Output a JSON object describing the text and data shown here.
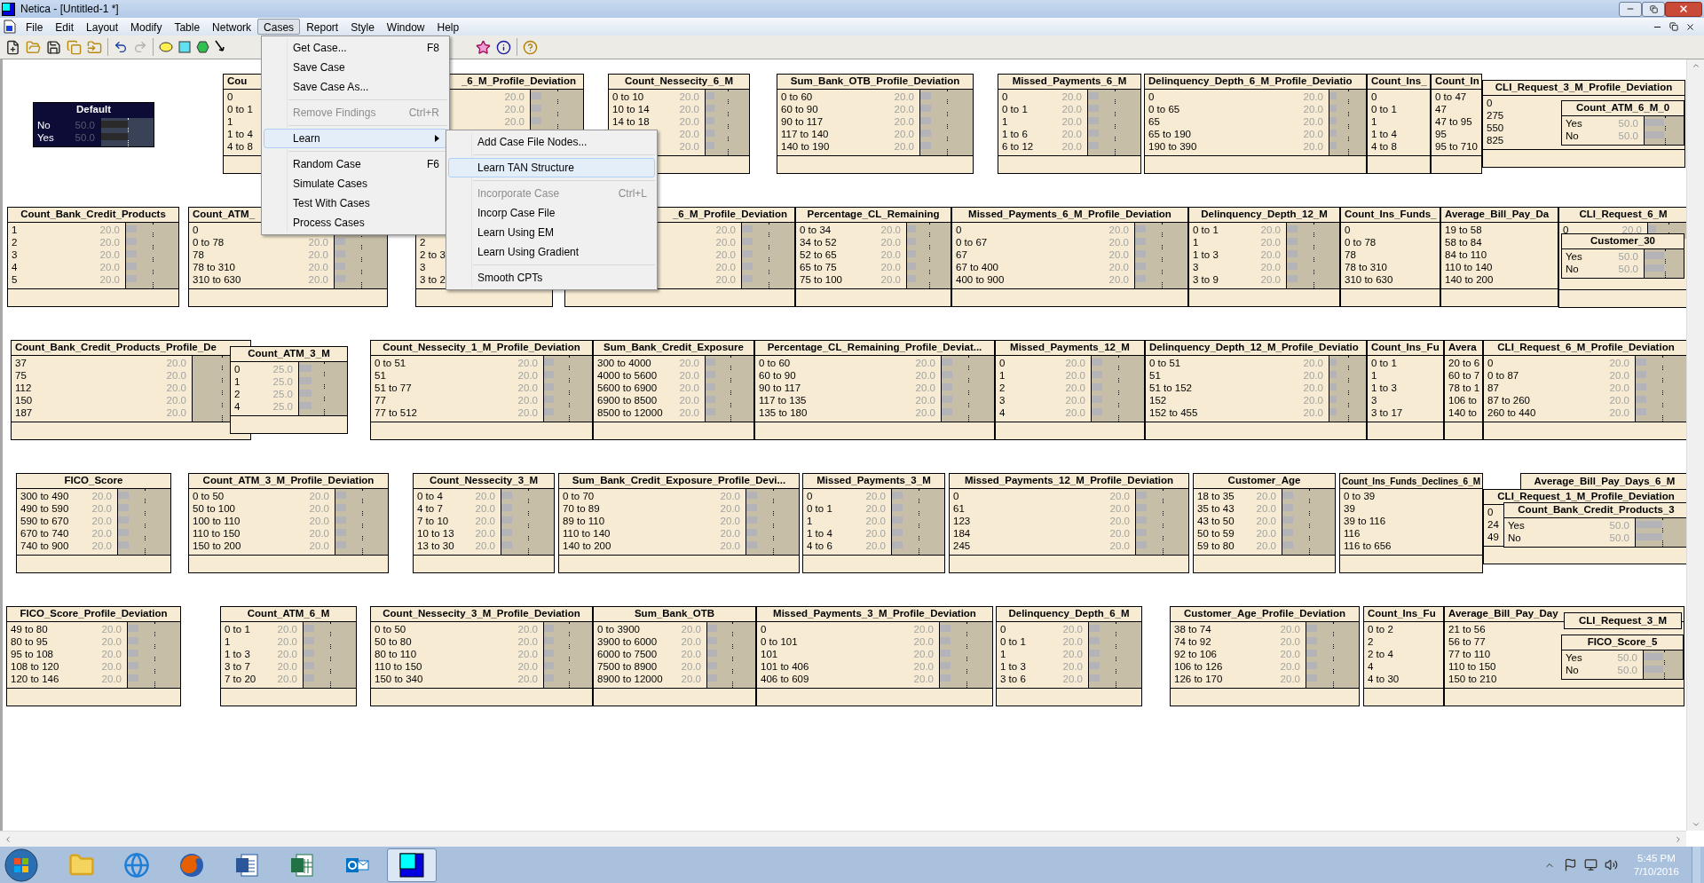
{
  "window": {
    "title": "Netica - [Untitled-1 *]"
  },
  "menu_bar": [
    {
      "label": "File",
      "selected": false
    },
    {
      "label": "Edit",
      "selected": false
    },
    {
      "label": "Layout",
      "selected": false
    },
    {
      "label": "Modify",
      "selected": false
    },
    {
      "label": "Table",
      "selected": false
    },
    {
      "label": "Network",
      "selected": false
    },
    {
      "label": "Cases",
      "selected": true
    },
    {
      "label": "Report",
      "selected": false
    },
    {
      "label": "Style",
      "selected": false
    },
    {
      "label": "Window",
      "selected": false
    },
    {
      "label": "Help",
      "selected": false
    }
  ],
  "cases_menu": {
    "groups": [
      [
        {
          "label": "Get Case...",
          "shortcut": "F8",
          "disabled": false,
          "selected": false
        },
        {
          "label": "Save Case",
          "disabled": false,
          "selected": false
        },
        {
          "label": "Save Case As...",
          "disabled": false,
          "selected": false
        }
      ],
      [
        {
          "label": "Remove Findings",
          "shortcut": "Ctrl+R",
          "disabled": true,
          "selected": false
        }
      ],
      [
        {
          "label": "Learn",
          "disabled": false,
          "selected": true,
          "submenu": true
        }
      ],
      [
        {
          "label": "Random Case",
          "shortcut": "F6",
          "disabled": false,
          "selected": false
        },
        {
          "label": "Simulate Cases",
          "disabled": false,
          "selected": false
        },
        {
          "label": "Test With Cases",
          "disabled": false,
          "selected": false
        },
        {
          "label": "Process Cases",
          "disabled": false,
          "selected": false
        }
      ]
    ]
  },
  "learn_submenu": {
    "groups": [
      [
        {
          "label": "Add Case File Nodes...",
          "disabled": false,
          "selected": false
        }
      ],
      [
        {
          "label": "Learn TAN Structure",
          "disabled": false,
          "selected": true
        }
      ],
      [
        {
          "label": "Incorporate Case",
          "shortcut": "Ctrl+L",
          "disabled": true,
          "selected": false
        },
        {
          "label": "Incorp Case File",
          "disabled": false,
          "selected": false
        },
        {
          "label": "Learn Using EM",
          "disabled": false,
          "selected": false
        },
        {
          "label": "Learn Using Gradient",
          "disabled": false,
          "selected": false
        }
      ],
      [
        {
          "label": "Smooth CPTs",
          "disabled": false,
          "selected": false
        }
      ]
    ]
  },
  "nodes": [
    {
      "title": "Default",
      "selected": true,
      "states": [
        {
          "label": "No",
          "value": "50.0",
          "level": 0.5
        },
        {
          "label": "Yes",
          "value": "50.0",
          "level": 0.5
        }
      ]
    },
    {
      "title": "Cou",
      "selected": false,
      "states": [
        {
          "label": "0"
        },
        {
          "label": "0 to 1"
        },
        {
          "label": "1"
        },
        {
          "label": "1 to 4"
        },
        {
          "label": "4 to 8"
        }
      ]
    },
    {
      "title": "_6_M_Profile_Deviation",
      "selected": false,
      "states": [
        {
          "value": "20.0",
          "level": 0.2
        },
        {
          "value": "20.0",
          "level": 0.2
        },
        {
          "value": "20.0",
          "level": 0.2
        }
      ]
    },
    {
      "title": "Count_Nessecity_6_M",
      "selected": false,
      "states": [
        {
          "label": "0 to 10",
          "value": "20.0",
          "level": 0.2
        },
        {
          "label": "10 to 14",
          "value": "20.0",
          "level": 0.2
        },
        {
          "label": "14 to 18",
          "value": "20.0",
          "level": 0.2
        },
        {
          "value": "20.0",
          "level": 0.2
        },
        {
          "value": "20.0",
          "level": 0.2
        }
      ]
    },
    {
      "title": "Sum_Bank_OTB_Profile_Deviation",
      "selected": false,
      "states": [
        {
          "label": "0 to 60",
          "value": "20.0",
          "level": 0.2
        },
        {
          "label": "60 to 90",
          "value": "20.0",
          "level": 0.2
        },
        {
          "label": "90 to 117",
          "value": "20.0",
          "level": 0.2
        },
        {
          "label": "117 to 140",
          "value": "20.0",
          "level": 0.2
        },
        {
          "label": "140 to 190",
          "value": "20.0",
          "level": 0.2
        }
      ]
    },
    {
      "title": "Missed_Payments_6_M",
      "selected": false,
      "states": [
        {
          "label": "0",
          "value": "20.0",
          "level": 0.2
        },
        {
          "label": "0 to 1",
          "value": "20.0",
          "level": 0.2
        },
        {
          "label": "1",
          "value": "20.0",
          "level": 0.2
        },
        {
          "label": "1 to 6",
          "value": "20.0",
          "level": 0.2
        },
        {
          "label": "6 to 12",
          "value": "20.0",
          "level": 0.2
        }
      ]
    },
    {
      "title": "Delinquency_Depth_6_M_Profile_Deviatio",
      "selected": false,
      "states": [
        {
          "label": "0",
          "value": "20.0",
          "level": 0.2
        },
        {
          "label": "0 to 65",
          "value": "20.0",
          "level": 0.2
        },
        {
          "label": "65",
          "value": "20.0",
          "level": 0.2
        },
        {
          "label": "65 to 190",
          "value": "20.0",
          "level": 0.2
        },
        {
          "label": "190 to 390",
          "value": "20.0",
          "level": 0.2
        }
      ]
    },
    {
      "title": "Count_Ins_",
      "selected": false,
      "states": [
        {
          "label": "0"
        },
        {
          "label": "0 to 1"
        },
        {
          "label": "1"
        },
        {
          "label": "1 to 4"
        },
        {
          "label": "4 to 8"
        }
      ]
    },
    {
      "title": "Count_In",
      "selected": false,
      "states": [
        {
          "label": "0 to 47"
        },
        {
          "label": "47"
        },
        {
          "label": "47 to 95"
        },
        {
          "label": "95"
        },
        {
          "label": "95 to 710"
        }
      ]
    },
    {
      "title": "CLI_Request_3_M_Profile_Deviation",
      "selected": false,
      "states": [
        {
          "label": "0"
        },
        {
          "label": "275"
        },
        {
          "label": "550"
        },
        {
          "label": "825"
        }
      ]
    },
    {
      "title": "Count_ATM_6_M_0",
      "selected": false,
      "states": [
        {
          "label": "Yes",
          "value": "50.0",
          "level": 0.5
        },
        {
          "label": "No",
          "value": "50.0",
          "level": 0.5
        }
      ]
    },
    {
      "title": "Count_Bank_Credit_Products",
      "selected": false,
      "states": [
        {
          "label": "1",
          "value": "20.0",
          "level": 0.2
        },
        {
          "label": "2",
          "value": "20.0",
          "level": 0.2
        },
        {
          "label": "3",
          "value": "20.0",
          "level": 0.2
        },
        {
          "label": "4",
          "value": "20.0",
          "level": 0.2
        },
        {
          "label": "5",
          "value": "20.0",
          "level": 0.2
        }
      ]
    },
    {
      "title": "Count_ATM_",
      "selected": false,
      "states": [
        {
          "label": "0"
        },
        {
          "label": "0 to 78",
          "value": "20.0",
          "level": 0.2
        },
        {
          "label": "78",
          "value": "20.0",
          "level": 0.2
        },
        {
          "label": "78 to 310",
          "value": "20.0",
          "level": 0.2
        },
        {
          "label": "310 to 630",
          "value": "20.0",
          "level": 0.2
        }
      ]
    },
    {
      "selected": false,
      "states": [
        {
          "label": "2"
        },
        {
          "label": "2 to 3"
        },
        {
          "label": "3"
        },
        {
          "label": "3 to 2"
        }
      ]
    },
    {
      "title": "_6_M_Profile_Deviation",
      "selected": false,
      "states": [
        {
          "value": "20.0",
          "level": 0.2
        },
        {
          "value": "20.0",
          "level": 0.2
        },
        {
          "value": "20.0",
          "level": 0.2
        },
        {
          "value": "20.0",
          "level": 0.2
        },
        {
          "value": "20.0",
          "level": 0.2
        }
      ]
    },
    {
      "title": "Percentage_CL_Remaining",
      "selected": false,
      "states": [
        {
          "label": "0 to 34",
          "value": "20.0",
          "level": 0.2
        },
        {
          "label": "34 to 52",
          "value": "20.0",
          "level": 0.2
        },
        {
          "label": "52 to 65",
          "value": "20.0",
          "level": 0.2
        },
        {
          "label": "65 to 75",
          "value": "20.0",
          "level": 0.2
        },
        {
          "label": "75 to 100",
          "value": "20.0",
          "level": 0.2
        }
      ]
    },
    {
      "title": "Missed_Payments_6_M_Profile_Deviation",
      "selected": false,
      "states": [
        {
          "label": "0",
          "value": "20.0",
          "level": 0.2
        },
        {
          "label": "0 to 67",
          "value": "20.0",
          "level": 0.2
        },
        {
          "label": "67",
          "value": "20.0",
          "level": 0.2
        },
        {
          "label": "67 to 400",
          "value": "20.0",
          "level": 0.2
        },
        {
          "label": "400 to 900",
          "value": "20.0",
          "level": 0.2
        }
      ]
    },
    {
      "title": "Delinquency_Depth_12_M",
      "selected": false,
      "states": [
        {
          "label": "0 to 1",
          "value": "20.0",
          "level": 0.2
        },
        {
          "label": "1",
          "value": "20.0",
          "level": 0.2
        },
        {
          "label": "1 to 3",
          "value": "20.0",
          "level": 0.2
        },
        {
          "label": "3",
          "value": "20.0",
          "level": 0.2
        },
        {
          "label": "3 to 9",
          "value": "20.0",
          "level": 0.2
        }
      ]
    },
    {
      "title": "Count_Ins_Funds_",
      "selected": false,
      "states": [
        {
          "label": "0"
        },
        {
          "label": "0 to 78"
        },
        {
          "label": "78"
        },
        {
          "label": "78 to 310"
        },
        {
          "label": "310 to 630"
        }
      ]
    },
    {
      "title": "Average_Bill_Pay_Da",
      "selected": false,
      "states": [
        {
          "label": "19 to 58"
        },
        {
          "label": "58 to 84"
        },
        {
          "label": "84 to 110"
        },
        {
          "label": "110 to 140"
        },
        {
          "label": "140 to 200"
        }
      ]
    },
    {
      "title": "CLI_Request_6_M",
      "selected": false,
      "states": [
        {
          "label": "0",
          "value": "20.0",
          "level": 0.2
        }
      ]
    },
    {
      "title": "Customer_30",
      "selected": false,
      "states": [
        {
          "label": "Yes",
          "value": "50.0",
          "level": 0.5
        },
        {
          "label": "No",
          "value": "50.0",
          "level": 0.5
        }
      ]
    },
    {
      "title": "Count_Bank_Credit_Products_Profile_De",
      "selected": false,
      "states": [
        {
          "label": "37",
          "value": "20.0"
        },
        {
          "label": "75",
          "value": "20.0"
        },
        {
          "label": "112",
          "value": "20.0"
        },
        {
          "label": "150",
          "value": "20.0"
        },
        {
          "label": "187",
          "value": "20.0"
        }
      ]
    },
    {
      "title": "Count_ATM_3_M",
      "selected": false,
      "states": [
        {
          "label": "0",
          "value": "25.0",
          "level": 0.25
        },
        {
          "label": "1",
          "value": "25.0",
          "level": 0.25
        },
        {
          "label": "2",
          "value": "25.0",
          "level": 0.25
        },
        {
          "label": "4",
          "value": "25.0",
          "level": 0.25
        }
      ]
    },
    {
      "title": "Count_Nessecity_1_M_Profile_Deviation",
      "selected": false,
      "states": [
        {
          "label": "0 to 51",
          "value": "20.0",
          "level": 0.2
        },
        {
          "label": "51",
          "value": "20.0",
          "level": 0.2
        },
        {
          "label": "51 to 77",
          "value": "20.0",
          "level": 0.2
        },
        {
          "label": "77",
          "value": "20.0",
          "level": 0.2
        },
        {
          "label": "77 to 512",
          "value": "20.0",
          "level": 0.2
        }
      ]
    },
    {
      "title": "Sum_Bank_Credit_Exposure",
      "selected": false,
      "states": [
        {
          "label": "300 to 4000",
          "value": "20.0",
          "level": 0.2
        },
        {
          "label": "4000 to 5600",
          "value": "20.0",
          "level": 0.2
        },
        {
          "label": "5600 to 6900",
          "value": "20.0",
          "level": 0.2
        },
        {
          "label": "6900 to 8500",
          "value": "20.0",
          "level": 0.2
        },
        {
          "label": "8500 to 12000",
          "value": "20.0",
          "level": 0.2
        }
      ]
    },
    {
      "title": "Percentage_CL_Remaining_Profile_Deviat...",
      "selected": false,
      "states": [
        {
          "label": "0 to 60",
          "value": "20.0",
          "level": 0.2
        },
        {
          "label": "60 to 90",
          "value": "20.0",
          "level": 0.2
        },
        {
          "label": "90 to 117",
          "value": "20.0",
          "level": 0.2
        },
        {
          "label": "117 to 135",
          "value": "20.0",
          "level": 0.2
        },
        {
          "label": "135 to 180",
          "value": "20.0",
          "level": 0.2
        }
      ]
    },
    {
      "title": "Missed_Payments_12_M",
      "selected": false,
      "states": [
        {
          "label": "0",
          "value": "20.0",
          "level": 0.2
        },
        {
          "label": "1",
          "value": "20.0",
          "level": 0.2
        },
        {
          "label": "2",
          "value": "20.0",
          "level": 0.2
        },
        {
          "label": "3",
          "value": "20.0",
          "level": 0.2
        },
        {
          "label": "4",
          "value": "20.0",
          "level": 0.2
        }
      ]
    },
    {
      "title": "Delinquency_Depth_12_M_Profile_Deviatio",
      "selected": false,
      "states": [
        {
          "label": "0 to 51",
          "value": "20.0",
          "level": 0.2
        },
        {
          "label": "51",
          "value": "20.0",
          "level": 0.2
        },
        {
          "label": "51 to 152",
          "value": "20.0",
          "level": 0.2
        },
        {
          "label": "152",
          "value": "20.0",
          "level": 0.2
        },
        {
          "label": "152 to 455",
          "value": "20.0",
          "level": 0.2
        }
      ]
    },
    {
      "title": "Count_Ins_Fu",
      "selected": false,
      "states": [
        {
          "label": "0 to 1"
        },
        {
          "label": "1"
        },
        {
          "label": "1 to 3"
        },
        {
          "label": "3"
        },
        {
          "label": "3 to 17"
        }
      ]
    },
    {
      "title": "Avera",
      "selected": false,
      "states": [
        {
          "label": "20 to 6"
        },
        {
          "label": "60 to 7"
        },
        {
          "label": "78 to 1"
        },
        {
          "label": "106 to"
        },
        {
          "label": "140 to"
        }
      ]
    },
    {
      "title": "CLI_Request_6_M_Profile_Deviation",
      "selected": false,
      "states": [
        {
          "label": "0",
          "value": "20.0",
          "level": 0.2
        },
        {
          "label": "0 to 87",
          "value": "20.0",
          "level": 0.2
        },
        {
          "label": "87",
          "value": "20.0",
          "level": 0.2
        },
        {
          "label": "87 to 260",
          "value": "20.0",
          "level": 0.2
        },
        {
          "label": "260 to 440",
          "value": "20.0",
          "level": 0.2
        }
      ]
    },
    {
      "title": "FICO_Score",
      "selected": false,
      "states": [
        {
          "label": "300 to 490",
          "value": "20.0",
          "level": 0.2
        },
        {
          "label": "490 to 590",
          "value": "20.0",
          "level": 0.2
        },
        {
          "label": "590 to 670",
          "value": "20.0",
          "level": 0.2
        },
        {
          "label": "670 to 740",
          "value": "20.0",
          "level": 0.2
        },
        {
          "label": "740 to 900",
          "value": "20.0",
          "level": 0.2
        }
      ]
    },
    {
      "title": "Count_ATM_3_M_Profile_Deviation",
      "selected": false,
      "states": [
        {
          "label": "0 to 50",
          "value": "20.0",
          "level": 0.2
        },
        {
          "label": "50 to 100",
          "value": "20.0",
          "level": 0.2
        },
        {
          "label": "100 to 110",
          "value": "20.0",
          "level": 0.2
        },
        {
          "label": "110 to 150",
          "value": "20.0",
          "level": 0.2
        },
        {
          "label": "150 to 200",
          "value": "20.0",
          "level": 0.2
        }
      ]
    },
    {
      "title": "Count_Nessecity_3_M",
      "selected": false,
      "states": [
        {
          "label": "0 to 4",
          "value": "20.0",
          "level": 0.2
        },
        {
          "label": "4 to 7",
          "value": "20.0",
          "level": 0.2
        },
        {
          "label": "7 to 10",
          "value": "20.0",
          "level": 0.2
        },
        {
          "label": "10 to 13",
          "value": "20.0",
          "level": 0.2
        },
        {
          "label": "13 to 30",
          "value": "20.0",
          "level": 0.2
        }
      ]
    },
    {
      "title": "Sum_Bank_Credit_Exposure_Profile_Devi...",
      "selected": false,
      "states": [
        {
          "label": "0 to 70",
          "value": "20.0",
          "level": 0.2
        },
        {
          "label": "70 to 89",
          "value": "20.0",
          "level": 0.2
        },
        {
          "label": "89 to 110",
          "value": "20.0",
          "level": 0.2
        },
        {
          "label": "110 to 140",
          "value": "20.0",
          "level": 0.2
        },
        {
          "label": "140 to 200",
          "value": "20.0",
          "level": 0.2
        }
      ]
    },
    {
      "title": "Missed_Payments_3_M",
      "selected": false,
      "states": [
        {
          "label": "0",
          "value": "20.0",
          "level": 0.2
        },
        {
          "label": "0 to 1",
          "value": "20.0",
          "level": 0.2
        },
        {
          "label": "1",
          "value": "20.0",
          "level": 0.2
        },
        {
          "label": "1 to 4",
          "value": "20.0",
          "level": 0.2
        },
        {
          "label": "4 to 6",
          "value": "20.0",
          "level": 0.2
        }
      ]
    },
    {
      "title": "Missed_Payments_12_M_Profile_Deviation",
      "selected": false,
      "states": [
        {
          "label": "0",
          "value": "20.0",
          "level": 0.2
        },
        {
          "label": "61",
          "value": "20.0",
          "level": 0.2
        },
        {
          "label": "123",
          "value": "20.0",
          "level": 0.2
        },
        {
          "label": "184",
          "value": "20.0",
          "level": 0.2
        },
        {
          "label": "245",
          "value": "20.0",
          "level": 0.2
        }
      ]
    },
    {
      "title": "Customer_Age",
      "selected": false,
      "states": [
        {
          "label": "18 to 35",
          "value": "20.0",
          "level": 0.2
        },
        {
          "label": "35 to 43",
          "value": "20.0",
          "level": 0.2
        },
        {
          "label": "43 to 50",
          "value": "20.0",
          "level": 0.2
        },
        {
          "label": "50 to 59",
          "value": "20.0",
          "level": 0.2
        },
        {
          "label": "59 to 80",
          "value": "20.0",
          "level": 0.2
        }
      ]
    },
    {
      "title": "Count_Ins_Funds_Declines_6_M",
      "selected": false,
      "states": [
        {
          "label": "0 to 39"
        },
        {
          "label": "39"
        },
        {
          "label": "39 to 116"
        },
        {
          "label": "116"
        },
        {
          "label": "116 to 656"
        }
      ]
    },
    {
      "title": "Average_Bill_Pay_Days_6_M",
      "selected": false
    },
    {
      "title": "CLI_Request_1_M_Profile_Deviation",
      "selected": false,
      "states": [
        {
          "label": "0"
        },
        {
          "label": "24"
        },
        {
          "label": "49"
        }
      ]
    },
    {
      "title": "Count_Bank_Credit_Products_3",
      "selected": false,
      "states": [
        {
          "label": "Yes",
          "value": "50.0",
          "level": 0.5
        },
        {
          "label": "No",
          "value": "50.0",
          "level": 0.5
        }
      ]
    },
    {
      "title": "FICO_Score_Profile_Deviation",
      "selected": false,
      "states": [
        {
          "label": "49 to 80",
          "value": "20.0",
          "level": 0.2
        },
        {
          "label": "80 to 95",
          "value": "20.0",
          "level": 0.2
        },
        {
          "label": "95 to 108",
          "value": "20.0",
          "level": 0.2
        },
        {
          "label": "108 to 120",
          "value": "20.0",
          "level": 0.2
        },
        {
          "label": "120 to 146",
          "value": "20.0",
          "level": 0.2
        }
      ]
    },
    {
      "title": "Count_ATM_6_M",
      "selected": false,
      "states": [
        {
          "label": "0 to 1",
          "value": "20.0",
          "level": 0.2
        },
        {
          "label": "1",
          "value": "20.0",
          "level": 0.2
        },
        {
          "label": "1 to 3",
          "value": "20.0",
          "level": 0.2
        },
        {
          "label": "3 to 7",
          "value": "20.0",
          "level": 0.2
        },
        {
          "label": "7 to 20",
          "value": "20.0",
          "level": 0.2
        }
      ]
    },
    {
      "title": "Count_Nessecity_3_M_Profile_Deviation",
      "selected": false,
      "states": [
        {
          "label": "0 to 50",
          "value": "20.0",
          "level": 0.2
        },
        {
          "label": "50 to 80",
          "value": "20.0",
          "level": 0.2
        },
        {
          "label": "80 to 110",
          "value": "20.0",
          "level": 0.2
        },
        {
          "label": "110 to 150",
          "value": "20.0",
          "level": 0.2
        },
        {
          "label": "150 to 340",
          "value": "20.0",
          "level": 0.2
        }
      ]
    },
    {
      "title": "Sum_Bank_OTB",
      "selected": false,
      "states": [
        {
          "label": "0 to 3900",
          "value": "20.0",
          "level": 0.2
        },
        {
          "label": "3900 to 6000",
          "value": "20.0",
          "level": 0.2
        },
        {
          "label": "6000 to 7500",
          "value": "20.0",
          "level": 0.2
        },
        {
          "label": "7500 to 8900",
          "value": "20.0",
          "level": 0.2
        },
        {
          "label": "8900 to 12000",
          "value": "20.0",
          "level": 0.2
        }
      ]
    },
    {
      "title": "Missed_Payments_3_M_Profile_Deviation",
      "selected": false,
      "states": [
        {
          "label": "0",
          "value": "20.0",
          "level": 0.2
        },
        {
          "label": "0 to 101",
          "value": "20.0",
          "level": 0.2
        },
        {
          "label": "101",
          "value": "20.0",
          "level": 0.2
        },
        {
          "label": "101 to 406",
          "value": "20.0",
          "level": 0.2
        },
        {
          "label": "406 to 609",
          "value": "20.0",
          "level": 0.2
        }
      ]
    },
    {
      "title": "Delinquency_Depth_6_M",
      "selected": false,
      "states": [
        {
          "label": "0",
          "value": "20.0",
          "level": 0.2
        },
        {
          "label": "0 to 1",
          "value": "20.0",
          "level": 0.2
        },
        {
          "label": "1",
          "value": "20.0",
          "level": 0.2
        },
        {
          "label": "1 to 3",
          "value": "20.0",
          "level": 0.2
        },
        {
          "label": "3 to 6",
          "value": "20.0",
          "level": 0.2
        }
      ]
    },
    {
      "title": "Customer_Age_Profile_Deviation",
      "selected": false,
      "states": [
        {
          "label": "38 to 74",
          "value": "20.0",
          "level": 0.2
        },
        {
          "label": "74 to 92",
          "value": "20.0",
          "level": 0.2
        },
        {
          "label": "92 to 106",
          "value": "20.0",
          "level": 0.2
        },
        {
          "label": "106 to 126",
          "value": "20.0",
          "level": 0.2
        },
        {
          "label": "126 to 170",
          "value": "20.0",
          "level": 0.2
        }
      ]
    },
    {
      "title": "Count_Ins_Fu",
      "selected": false,
      "states": [
        {
          "label": "0 to 2"
        },
        {
          "label": "2"
        },
        {
          "label": "2 to 4"
        },
        {
          "label": "4"
        },
        {
          "label": "4 to 30"
        }
      ]
    },
    {
      "title": "Average_Bill_Pay_Day",
      "selected": false,
      "states": [
        {
          "label": "21 to 56"
        },
        {
          "label": "56 to 77"
        },
        {
          "label": "77 to 110"
        },
        {
          "label": "110 to 150"
        },
        {
          "label": "150 to 210"
        }
      ]
    },
    {
      "title": "CLI_Request_3_M",
      "selected": false
    },
    {
      "title": "FICO_Score_5",
      "selected": false,
      "states": [
        {
          "label": "Yes",
          "value": "50.0",
          "level": 0.5
        },
        {
          "label": "No",
          "value": "50.0",
          "level": 0.5
        }
      ]
    }
  ],
  "taskbar": {
    "apps": [
      {
        "kind": "explorer",
        "selected": false
      },
      {
        "kind": "browser",
        "selected": false
      },
      {
        "kind": "firefox",
        "selected": false
      },
      {
        "kind": "word",
        "selected": false
      },
      {
        "kind": "excel",
        "selected": false
      },
      {
        "kind": "outlook",
        "selected": false
      },
      {
        "kind": "netica",
        "selected": true
      }
    ],
    "time": "5:45 PM",
    "date": "7/10/2016"
  }
}
